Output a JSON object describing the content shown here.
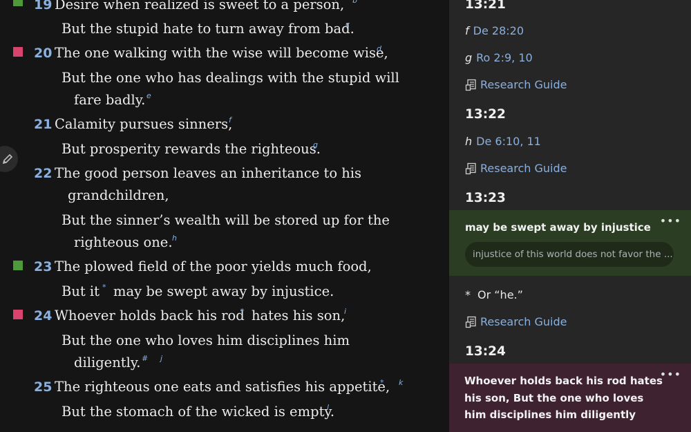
{
  "reader": {
    "verses": [
      {
        "num": "19",
        "line1": "Desire when realized is sweet to a person,",
        "fn1a": "*",
        "fn1b": "b",
        "line2": "But the stupid hate to turn away from bad.",
        "fn2": "c"
      },
      {
        "num": "20",
        "line1": "The one walking with the wise will become wise,",
        "fn1": "d",
        "line2": "But the one who has dealings with the stupid will",
        "line3": "fare badly.",
        "fn3": "e"
      },
      {
        "num": "21",
        "line1": "Calamity pursues sinners,",
        "fn1": "f",
        "line2": "But prosperity rewards the righteous.",
        "fn2": "g"
      },
      {
        "num": "22",
        "line1": "The good person leaves an inheritance to his",
        "line1b": "grandchildren,",
        "line2": "But the sinner’s wealth will be stored up for the",
        "line3": "righteous one.",
        "fn3": "h"
      },
      {
        "num": "23",
        "line1": "The plowed field of the poor yields much food,",
        "line2a": "But it",
        "fn2a": "*",
        "line2b": "may be swept away by injustice."
      },
      {
        "num": "24",
        "line1a": "Whoever holds back his rod",
        "fn1a": "*",
        "line1b": "hates his son,",
        "fn1b": "i",
        "line2": "But the one who loves him disciplines him",
        "line3": "diligently.",
        "fn3a": "#",
        "fn3b": "j"
      },
      {
        "num": "25",
        "line1": "The righteous one eats and satisfies his appetite,",
        "fn1a": "*",
        "fn1b": "k",
        "line2": "But the stomach of the wicked is empty.",
        "fn2": "l"
      }
    ]
  },
  "sidebar": {
    "h1321": "13:21",
    "ref_f": {
      "letter": "f",
      "text": "De 28:20"
    },
    "ref_g": {
      "letter": "g",
      "text": "Ro 2:9, 10"
    },
    "research_guide": "Research Guide",
    "h1322": "13:22",
    "ref_h": {
      "letter": "h",
      "text": "De 6:10, 11"
    },
    "h1323": "13:23",
    "note_green": {
      "title": "may be swept away by injustice",
      "body": "injustice of this world does not favor the ..."
    },
    "star_note": {
      "mark": "*",
      "text": "Or “he.”"
    },
    "h1324": "13:24",
    "note_pink": {
      "title": "Whoever holds back his rod hates his son, But the one who loves him disciplines him diligently"
    },
    "more": "•••",
    "colors": {
      "green_highlight": "#4e9a3a",
      "pink_highlight": "#d9436e",
      "link": "#8ab0e0"
    }
  }
}
